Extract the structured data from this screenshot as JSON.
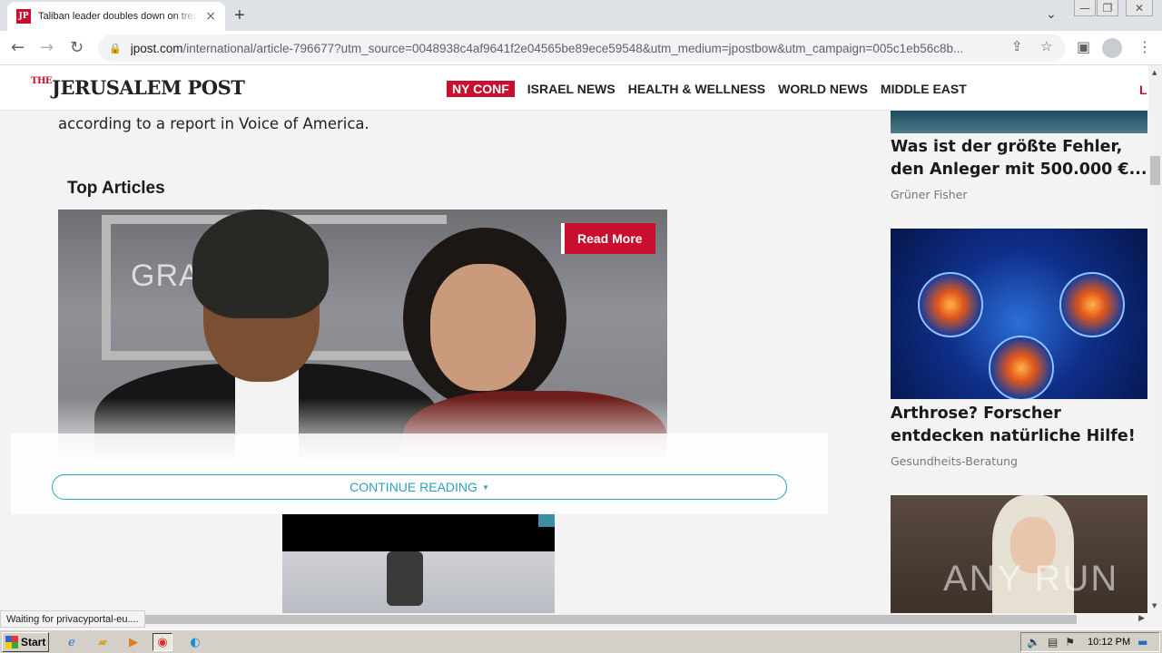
{
  "browser": {
    "tab": {
      "title": "Taliban leader doubles down on treat",
      "favicon_text": "JP",
      "close_icon": "×"
    },
    "new_tab_icon": "+",
    "tab_search_icon": "⌄",
    "window_controls": [
      "—",
      "❐",
      "✕"
    ],
    "address_bar": {
      "domain": "jpost.com",
      "path": "/international/article-796677?utm_source=0048938c4af9641f2e04565be89ece59548&utm_medium=jpostbow&utm_campaign=005c1eb56c8b..."
    },
    "status_text": "Waiting for privacyportal-eu...."
  },
  "site": {
    "logo": {
      "small": "THE",
      "main": "JERUSALEM POST"
    },
    "nav": [
      "NY CONF",
      "ISRAEL NEWS",
      "HEALTH & WELLNESS",
      "WORLD NEWS",
      "MIDDLE EAST"
    ],
    "nav_cut": "L",
    "accent_color": "#c8102e"
  },
  "article": {
    "body_line": "according to a report in Voice of America.",
    "top_articles_heading": "Top Articles",
    "photo_text": "GRAM          DS",
    "read_more": "Read More",
    "continue_reading": "CONTINUE READING",
    "continue_caret": "▼"
  },
  "sidebar": {
    "ads": [
      {
        "title": "Was ist der größte Fehler, den Anleger mit 500.000 €...",
        "source": "Grüner Fisher"
      },
      {
        "title": "Arthrose? Forscher entdecken natürliche Hilfe!",
        "source": "Gesundheits-Beratung"
      },
      {
        "title": "",
        "source": "",
        "watermark": "ANY RUN"
      }
    ]
  },
  "taskbar": {
    "start_label": "Start",
    "clock": "10:12 PM"
  }
}
